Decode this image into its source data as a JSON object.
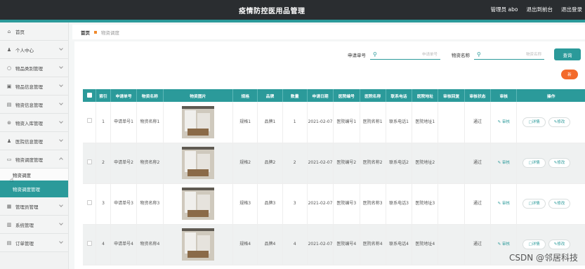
{
  "header": {
    "title": "疫情防控医用品管理",
    "links": [
      "管理员 abo",
      "退出到前台",
      "退出登录"
    ]
  },
  "sidebar": {
    "items": [
      {
        "label": "首页",
        "icon": "home-icon",
        "glyph": "⌂"
      },
      {
        "label": "个人中心",
        "icon": "user-icon",
        "glyph": "♟"
      },
      {
        "label": "物品类别管理",
        "icon": "circle-icon",
        "glyph": "○"
      },
      {
        "label": "物品信息管理",
        "icon": "box-icon",
        "glyph": "▣"
      },
      {
        "label": "物资信息管理",
        "icon": "list-icon",
        "glyph": "▤"
      },
      {
        "label": "物资入库管理",
        "icon": "inbox-icon",
        "glyph": "⊛"
      },
      {
        "label": "医院信息管理",
        "icon": "hospital-icon",
        "glyph": "♟"
      },
      {
        "label": "物资调度管理",
        "icon": "chat-icon",
        "glyph": "▭"
      }
    ],
    "sub_items": [
      "物资调度",
      "物资调度管理"
    ],
    "items2": [
      {
        "label": "管理员管理",
        "icon": "admin-icon",
        "glyph": "▦"
      },
      {
        "label": "系统管理",
        "icon": "system-icon",
        "glyph": "▥"
      },
      {
        "label": "订单管理",
        "icon": "order-icon",
        "glyph": "▤"
      }
    ]
  },
  "breadcrumb": {
    "home": "首页",
    "current": "物资调度"
  },
  "search": {
    "field1_label": "申请单号",
    "field1_placeholder": "申请单号",
    "field2_label": "物资名称",
    "field2_placeholder": "物资名称",
    "query_label": "查询",
    "add_label": "新"
  },
  "table": {
    "headers": [
      "索引",
      "申请单号",
      "物资名称",
      "物资图片",
      "规格",
      "品牌",
      "数量",
      "申请日期",
      "医院编号",
      "医院名称",
      "联系电话",
      "医院地址",
      "审核回复",
      "审核状态",
      "审核",
      "操作"
    ],
    "audit_link": "审核",
    "detail_label": "详情",
    "edit_label": "修改",
    "rows": [
      {
        "idx": "1",
        "apply_no": "申请单号1",
        "name": "物资名称1",
        "spec": "规格1",
        "brand": "品牌1",
        "qty": "1",
        "date": "2021-02-07",
        "hosp_no": "医院编号1",
        "hosp_name": "医院名称1",
        "phone": "联系电话1",
        "addr": "医院地址1",
        "reply": "",
        "status": "通过"
      },
      {
        "idx": "2",
        "apply_no": "申请单号2",
        "name": "物资名称2",
        "spec": "规格2",
        "brand": "品牌2",
        "qty": "2",
        "date": "2021-02-07",
        "hosp_no": "医院编号2",
        "hosp_name": "医院名称2",
        "phone": "联系电话2",
        "addr": "医院地址2",
        "reply": "",
        "status": "通过"
      },
      {
        "idx": "3",
        "apply_no": "申请单号3",
        "name": "物资名称3",
        "spec": "规格3",
        "brand": "品牌3",
        "qty": "3",
        "date": "2021-02-07",
        "hosp_no": "医院编号3",
        "hosp_name": "医院名称3",
        "phone": "联系电话3",
        "addr": "医院地址3",
        "reply": "",
        "status": "通过"
      },
      {
        "idx": "4",
        "apply_no": "申请单号4",
        "name": "物资名称4",
        "spec": "规格4",
        "brand": "品牌4",
        "qty": "4",
        "date": "2021-02-07",
        "hosp_no": "医院编号4",
        "hosp_name": "医院名称4",
        "phone": "联系电话4",
        "addr": "医院地址4",
        "reply": "",
        "status": "通过"
      }
    ]
  },
  "watermark": "CSDN @邻居科技",
  "colors": {
    "accent": "#2b9a9a",
    "header_bg": "#2a2d30",
    "orange": "#f36a2b"
  }
}
